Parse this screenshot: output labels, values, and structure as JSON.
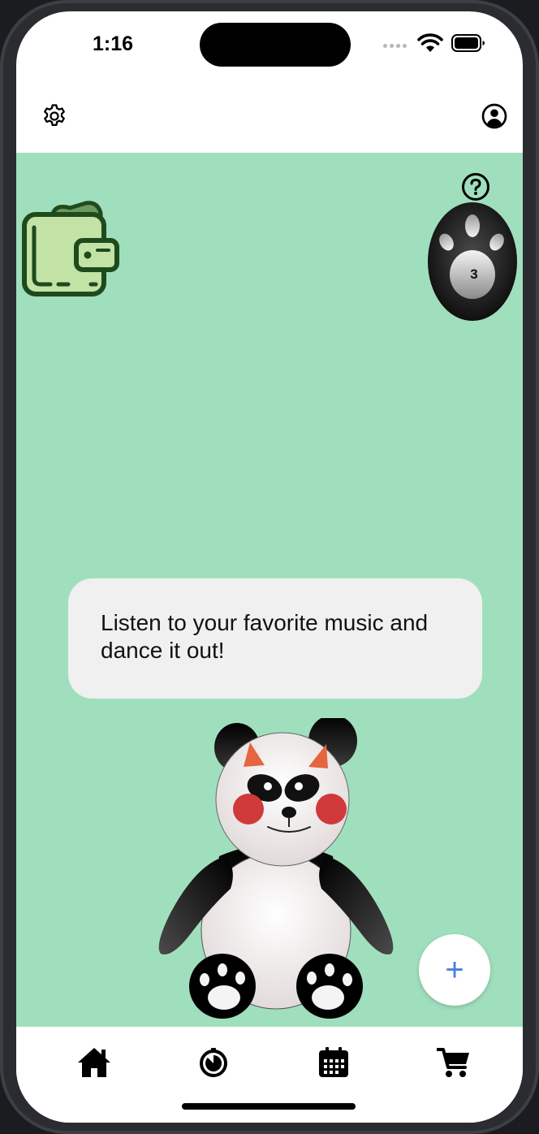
{
  "status_bar": {
    "time": "1:16",
    "icons": [
      "cellular-signal-icon",
      "wifi-icon",
      "battery-icon"
    ]
  },
  "header": {
    "left_icon": "gear-icon",
    "right_icon": "user-circle-icon"
  },
  "main": {
    "background_color": "#a0dfbd",
    "wallet_icon": "wallet-icon",
    "help_icon": "question-circle-icon",
    "paw_badge": {
      "icon": "paw-icon",
      "count": "3"
    },
    "speech_bubble": {
      "text": "Listen to your favorite music and dance it out!"
    },
    "mascot": "panda-mascot",
    "fab_label": "+"
  },
  "bottom_nav": {
    "items": [
      {
        "icon": "home-icon",
        "name": "home"
      },
      {
        "icon": "timer-icon",
        "name": "timer"
      },
      {
        "icon": "calendar-icon",
        "name": "calendar"
      },
      {
        "icon": "cart-icon",
        "name": "cart"
      }
    ]
  },
  "colors": {
    "accent_blue": "#4a7fdc",
    "bubble_bg": "#f0f0f0",
    "panda_cheek": "#d0393a",
    "panda_horn": "#e5653e",
    "wallet_fill": "#c2e2a6",
    "wallet_stroke": "#1f4a1c"
  }
}
